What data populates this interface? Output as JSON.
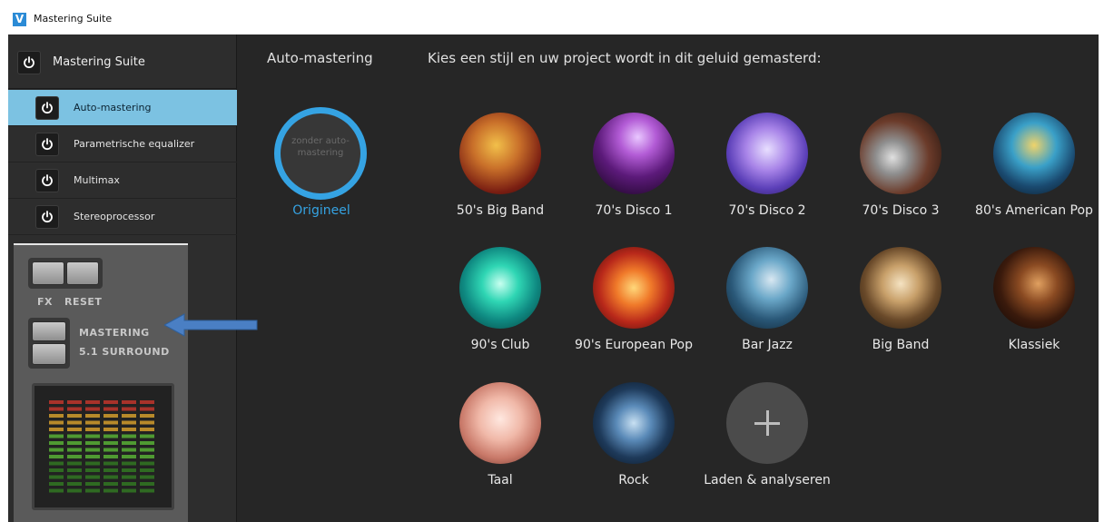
{
  "window": {
    "title": "Mastering Suite",
    "logo": "V"
  },
  "sidebar": {
    "header": {
      "label": "Mastering Suite"
    },
    "items": [
      {
        "label": "Auto-mastering",
        "active": true
      },
      {
        "label": "Parametrische equalizer",
        "active": false
      },
      {
        "label": "Multimax",
        "active": false
      },
      {
        "label": "Stereoprocessor",
        "active": false
      }
    ]
  },
  "overlay": {
    "fx_label": "FX",
    "reset_label": "RESET",
    "mastering_label": "MASTERING",
    "surround_label": "5.1 SURROUND"
  },
  "main": {
    "title": "Auto-mastering",
    "prompt": "Kies een stijl en uw project wordt in dit geluid gemasterd:",
    "original": {
      "circle_text": "zonder auto-mastering",
      "label": "Origineel"
    },
    "styles": [
      {
        "label": "50's Big Band"
      },
      {
        "label": "70's Disco 1"
      },
      {
        "label": "70's Disco 2"
      },
      {
        "label": "70's Disco 3"
      },
      {
        "label": "80's American Pop"
      },
      {
        "label": "90's Club"
      },
      {
        "label": "90's European Pop"
      },
      {
        "label": "Bar Jazz"
      },
      {
        "label": "Big Band"
      },
      {
        "label": "Klassiek"
      },
      {
        "label": "Taal"
      },
      {
        "label": "Rock"
      }
    ],
    "add": {
      "label": "Laden & analyseren"
    }
  },
  "colors": {
    "accent": "#35a3e3",
    "active_item": "#7cc2e2",
    "background": "#262626",
    "arrow": "#4a7fc4"
  }
}
